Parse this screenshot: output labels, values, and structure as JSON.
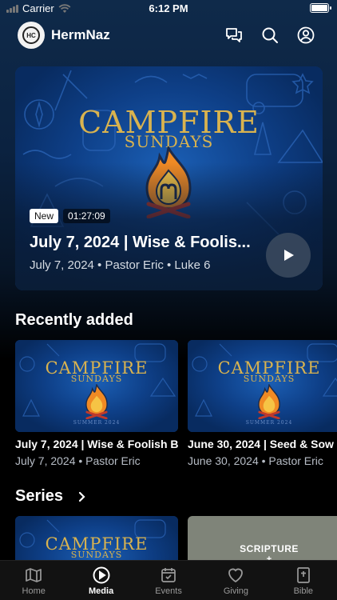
{
  "status_bar": {
    "carrier": "Carrier",
    "time": "6:12 PM"
  },
  "header": {
    "app_name": "HermNaz",
    "logo_text": "HC"
  },
  "artwork": {
    "line1": "CAMPFIRE",
    "line2": "SUNDAYS",
    "small_caption": "SUMMER 2024"
  },
  "hero": {
    "badge_new": "New",
    "duration": "01:27:09",
    "title": "July 7, 2024 | Wise & Foolis...",
    "meta": "July 7, 2024 • Pastor Eric • Luke 6"
  },
  "recently_added": {
    "title": "Recently added",
    "items": [
      {
        "title": "July 7, 2024 | Wise & Foolish B",
        "meta": "July 7, 2024 • Pastor Eric"
      },
      {
        "title": "June 30, 2024 | Seed & Sow",
        "meta": "June 30, 2024 • Pastor Eric"
      }
    ]
  },
  "series": {
    "title": "Series",
    "items": [
      {
        "kind": "campfire"
      },
      {
        "kind": "scripture",
        "label": "SCRIPTURE"
      }
    ]
  },
  "tabs": [
    {
      "label": "Home",
      "icon": "map-icon",
      "active": false
    },
    {
      "label": "Media",
      "icon": "play-circle-icon",
      "active": true
    },
    {
      "label": "Events",
      "icon": "calendar-icon",
      "active": false
    },
    {
      "label": "Giving",
      "icon": "heart-icon",
      "active": false
    },
    {
      "label": "Bible",
      "icon": "bible-icon",
      "active": false
    }
  ],
  "colors": {
    "accent_gold": "#d9b34f",
    "art_blue": "#0e3f87",
    "flame_orange": "#f08a24"
  }
}
